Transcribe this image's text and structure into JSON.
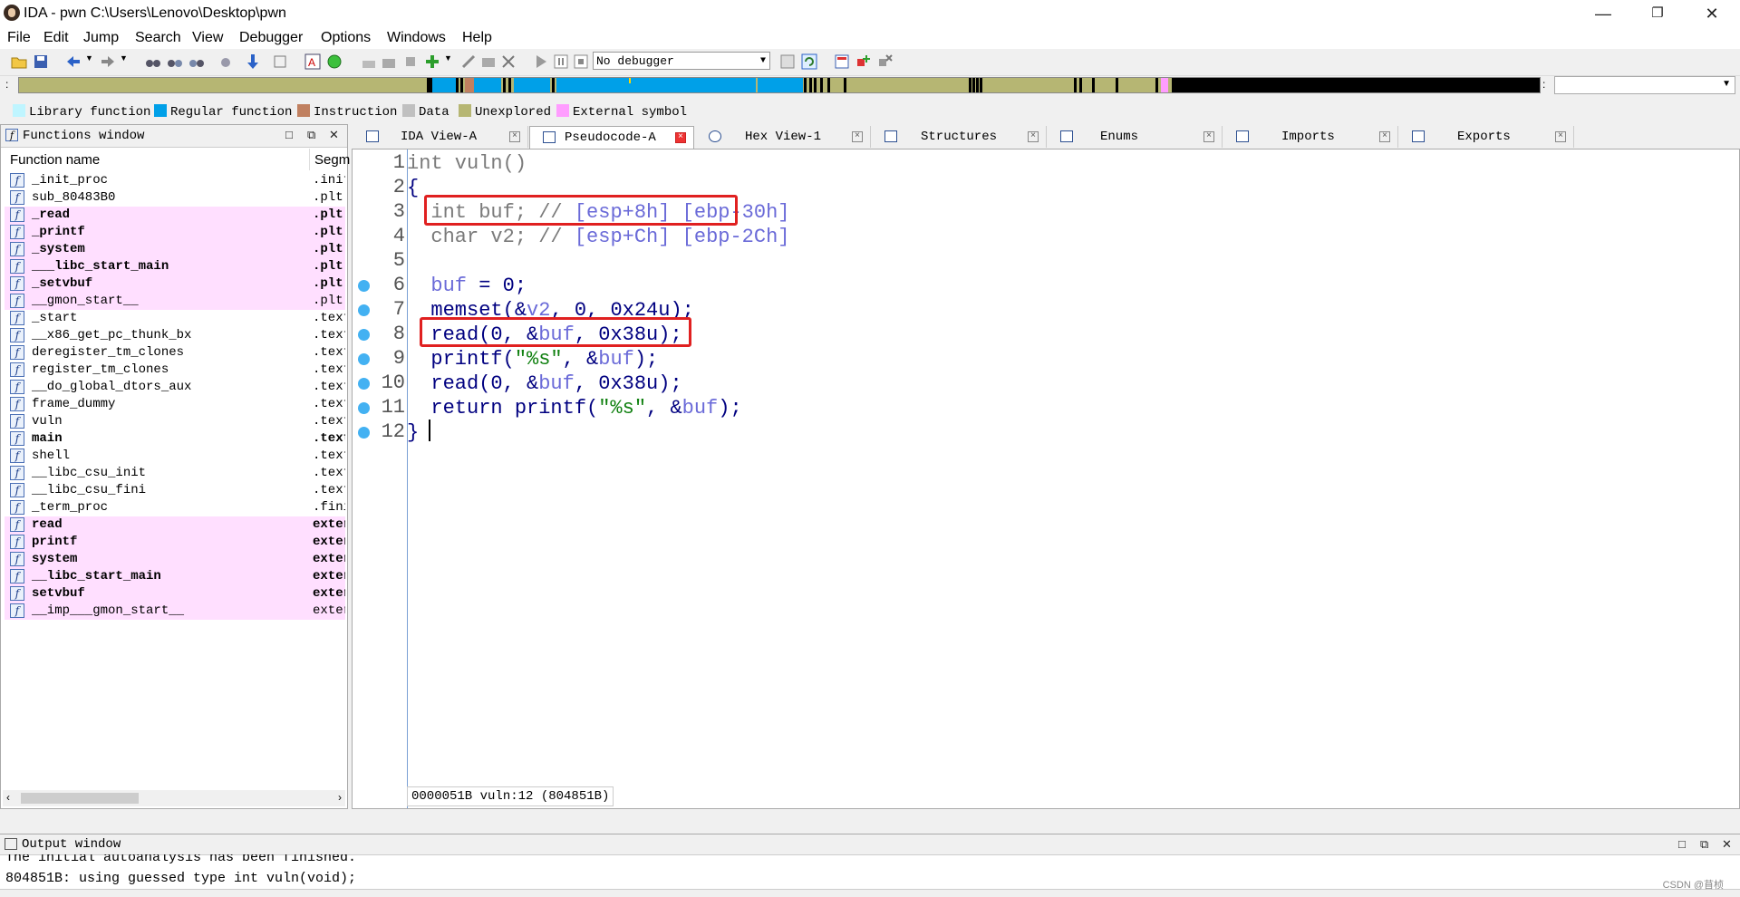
{
  "window": {
    "title": "IDA - pwn C:\\Users\\Lenovo\\Desktop\\pwn",
    "minimize": "—",
    "restore": "❐",
    "close": "✕"
  },
  "menu": [
    "File",
    "Edit",
    "Jump",
    "Search",
    "View",
    "Debugger",
    "Options",
    "Windows",
    "Help"
  ],
  "toolbar": {
    "debugger": "No debugger"
  },
  "legend": [
    {
      "label": "Library function",
      "color": "#bff5ff"
    },
    {
      "label": "Regular function",
      "color": "#00a0e8"
    },
    {
      "label": "Instruction",
      "color": "#c08060"
    },
    {
      "label": "Data",
      "color": "#c0c0c0"
    },
    {
      "label": "Unexplored",
      "color": "#b6b673"
    },
    {
      "label": "External symbol",
      "color": "#ff9dff"
    }
  ],
  "functions": {
    "title": "Functions window",
    "col_name": "Function name",
    "col_segment": "Segm",
    "rows": [
      {
        "name": "_init_proc",
        "seg": ".init",
        "pink": false,
        "bold": false
      },
      {
        "name": "sub_80483B0",
        "seg": ".plt",
        "pink": false,
        "bold": false
      },
      {
        "name": "_read",
        "seg": ".plt",
        "pink": true,
        "bold": true
      },
      {
        "name": "_printf",
        "seg": ".plt",
        "pink": true,
        "bold": true
      },
      {
        "name": "_system",
        "seg": ".plt",
        "pink": true,
        "bold": true
      },
      {
        "name": "___libc_start_main",
        "seg": ".plt",
        "pink": true,
        "bold": true
      },
      {
        "name": "_setvbuf",
        "seg": ".plt",
        "pink": true,
        "bold": true
      },
      {
        "name": "__gmon_start__",
        "seg": ".plt.",
        "pink": true,
        "bold": false
      },
      {
        "name": "_start",
        "seg": ".text",
        "pink": false,
        "bold": false
      },
      {
        "name": "__x86_get_pc_thunk_bx",
        "seg": ".text",
        "pink": false,
        "bold": false
      },
      {
        "name": "deregister_tm_clones",
        "seg": ".text",
        "pink": false,
        "bold": false
      },
      {
        "name": "register_tm_clones",
        "seg": ".text",
        "pink": false,
        "bold": false
      },
      {
        "name": "__do_global_dtors_aux",
        "seg": ".text",
        "pink": false,
        "bold": false
      },
      {
        "name": "frame_dummy",
        "seg": ".text",
        "pink": false,
        "bold": false
      },
      {
        "name": "vuln",
        "seg": ".text",
        "pink": false,
        "bold": false
      },
      {
        "name": "main",
        "seg": ".text",
        "pink": false,
        "bold": true
      },
      {
        "name": "shell",
        "seg": ".text",
        "pink": false,
        "bold": false
      },
      {
        "name": "__libc_csu_init",
        "seg": ".text",
        "pink": false,
        "bold": false
      },
      {
        "name": "__libc_csu_fini",
        "seg": ".text",
        "pink": false,
        "bold": false
      },
      {
        "name": "_term_proc",
        "seg": ".fini",
        "pink": false,
        "bold": false
      },
      {
        "name": "read",
        "seg": "exter",
        "pink": true,
        "bold": true
      },
      {
        "name": "printf",
        "seg": "exter",
        "pink": true,
        "bold": true
      },
      {
        "name": "system",
        "seg": "exter",
        "pink": true,
        "bold": true
      },
      {
        "name": "__libc_start_main",
        "seg": "exter",
        "pink": true,
        "bold": true
      },
      {
        "name": "setvbuf",
        "seg": "exter",
        "pink": true,
        "bold": true
      },
      {
        "name": "__imp___gmon_start__",
        "seg": "exter",
        "pink": true,
        "bold": false
      }
    ]
  },
  "tabs": [
    "IDA View-A",
    "Pseudocode-A",
    "Hex View-1",
    "Structures",
    "Enums",
    "Imports",
    "Exports"
  ],
  "code": {
    "line_numbers": [
      "1",
      "2",
      "3",
      "4",
      "5",
      "6",
      "7",
      "8",
      "9",
      "10",
      "11",
      "12"
    ],
    "lines": [
      {
        "no": "1",
        "parts": [
          [
            "gr",
            "int vuln()"
          ]
        ]
      },
      {
        "no": "2",
        "parts": [
          [
            "kw",
            "{"
          ]
        ]
      },
      {
        "no": "3",
        "parts": [
          [
            "gr",
            "  int buf; // "
          ],
          [
            "va",
            "[esp+8h] [ebp-30h]"
          ]
        ]
      },
      {
        "no": "4",
        "parts": [
          [
            "gr",
            "  char v2; // "
          ],
          [
            "va",
            "[esp+Ch] [ebp-2Ch]"
          ]
        ]
      },
      {
        "no": "5",
        "parts": [
          [
            "gr",
            ""
          ]
        ]
      },
      {
        "no": "6",
        "parts": [
          [
            "va",
            "  buf"
          ],
          [
            "kw",
            " = 0;"
          ]
        ]
      },
      {
        "no": "7",
        "parts": [
          [
            "kw",
            "  memset(&"
          ],
          [
            "va",
            "v2"
          ],
          [
            "kw",
            ", 0, 0x24u);"
          ]
        ]
      },
      {
        "no": "8",
        "parts": [
          [
            "kw",
            "  read(0, &"
          ],
          [
            "va",
            "buf"
          ],
          [
            "kw",
            ", 0x38u);"
          ]
        ]
      },
      {
        "no": "9",
        "parts": [
          [
            "kw",
            "  printf("
          ],
          [
            "st",
            "\"%s\""
          ],
          [
            "kw",
            ", &"
          ],
          [
            "va",
            "buf"
          ],
          [
            "kw",
            ");"
          ]
        ]
      },
      {
        "no": "10",
        "parts": [
          [
            "kw",
            "  read(0, &"
          ],
          [
            "va",
            "buf"
          ],
          [
            "kw",
            ", 0x38u);"
          ]
        ]
      },
      {
        "no": "11",
        "parts": [
          [
            "kw",
            "  return printf("
          ],
          [
            "st",
            "\"%s\""
          ],
          [
            "kw",
            ", &"
          ],
          [
            "va",
            "buf"
          ],
          [
            "kw",
            ");"
          ]
        ]
      },
      {
        "no": "12",
        "parts": [
          [
            "kw",
            "}"
          ]
        ]
      }
    ],
    "status": "0000051B vuln:12 (804851B)"
  },
  "output": {
    "title": "Output window",
    "lines": [
      "The initial autoanalysis has been finished.",
      "804851B: using guessed type int vuln(void);"
    ]
  },
  "watermark": "CSDN @苜桢"
}
